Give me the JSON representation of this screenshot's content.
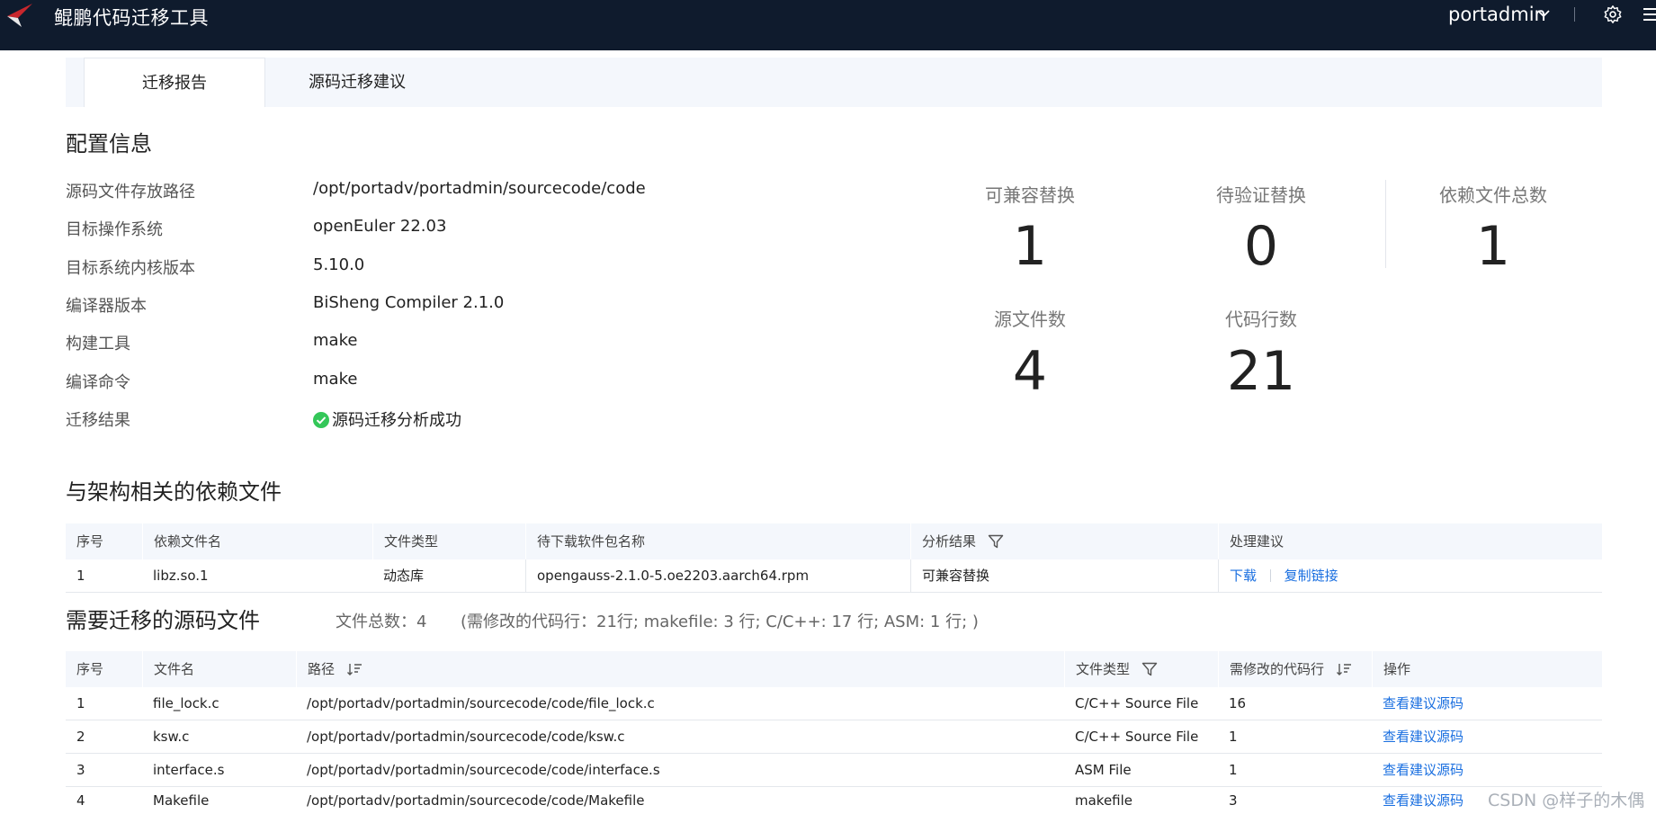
{
  "header": {
    "app_title": "鲲鹏代码迁移工具",
    "user": "portadmin",
    "logo_icon": "kunpeng-logo",
    "colors": {
      "bar": "#0f1b2d",
      "accent": "#c8272d",
      "link": "#1a6fe0",
      "success": "#34c759"
    }
  },
  "tabs": [
    {
      "label": "迁移报告",
      "active": true
    },
    {
      "label": "源码迁移建议",
      "active": false
    }
  ],
  "config": {
    "title": "配置信息",
    "rows": [
      {
        "label": "源码文件存放路径",
        "value": "/opt/portadv/portadmin/sourcecode/code"
      },
      {
        "label": "目标操作系统",
        "value": "openEuler 22.03"
      },
      {
        "label": "目标系统内核版本",
        "value": "5.10.0"
      },
      {
        "label": "编译器版本",
        "value": "BiSheng Compiler 2.1.0"
      },
      {
        "label": "构建工具",
        "value": "make"
      },
      {
        "label": "编译命令",
        "value": "make"
      },
      {
        "label": "迁移结果",
        "value": "源码迁移分析成功"
      }
    ]
  },
  "stats": {
    "compatible": {
      "label": "可兼容替换",
      "value": "1"
    },
    "pending": {
      "label": "待验证替换",
      "value": "0"
    },
    "deps_total": {
      "label": "依赖文件总数",
      "value": "1"
    },
    "source_files": {
      "label": "源文件数",
      "value": "4"
    },
    "code_lines": {
      "label": "代码行数",
      "value": "21"
    }
  },
  "deps": {
    "title": "与架构相关的依赖文件",
    "columns": [
      "序号",
      "依赖文件名",
      "文件类型",
      "待下载软件包名称",
      "分析结果",
      "处理建议"
    ],
    "rows": [
      {
        "no": "1",
        "name": "libz.so.1",
        "type": "动态库",
        "package": "opengauss-2.1.0-5.oe2203.aarch64.rpm",
        "result": "可兼容替换",
        "action1": "下载",
        "action2": "复制链接"
      }
    ]
  },
  "sources": {
    "title": "需要迁移的源码文件",
    "total": "文件总数：4",
    "summary": "(需修改的代码行：21行; makefile: 3 行; C/C++: 17 行; ASM: 1 行; )",
    "columns": [
      "序号",
      "文件名",
      "路径",
      "文件类型",
      "需修改的代码行",
      "操作"
    ],
    "rows": [
      {
        "no": "1",
        "name": "file_lock.c",
        "path": "/opt/portadv/portadmin/sourcecode/code/file_lock.c",
        "type": "C/C++ Source File",
        "lines": "16",
        "action": "查看建议源码"
      },
      {
        "no": "2",
        "name": "ksw.c",
        "path": "/opt/portadv/portadmin/sourcecode/code/ksw.c",
        "type": "C/C++ Source File",
        "lines": "1",
        "action": "查看建议源码"
      },
      {
        "no": "3",
        "name": "interface.s",
        "path": "/opt/portadv/portadmin/sourcecode/code/interface.s",
        "type": "ASM File",
        "lines": "1",
        "action": "查看建议源码"
      },
      {
        "no": "4",
        "name": "Makefile",
        "path": "/opt/portadv/portadmin/sourcecode/code/Makefile",
        "type": "makefile",
        "lines": "3",
        "action": "查看建议源码"
      }
    ]
  },
  "watermark": "CSDN @样子的木偶"
}
